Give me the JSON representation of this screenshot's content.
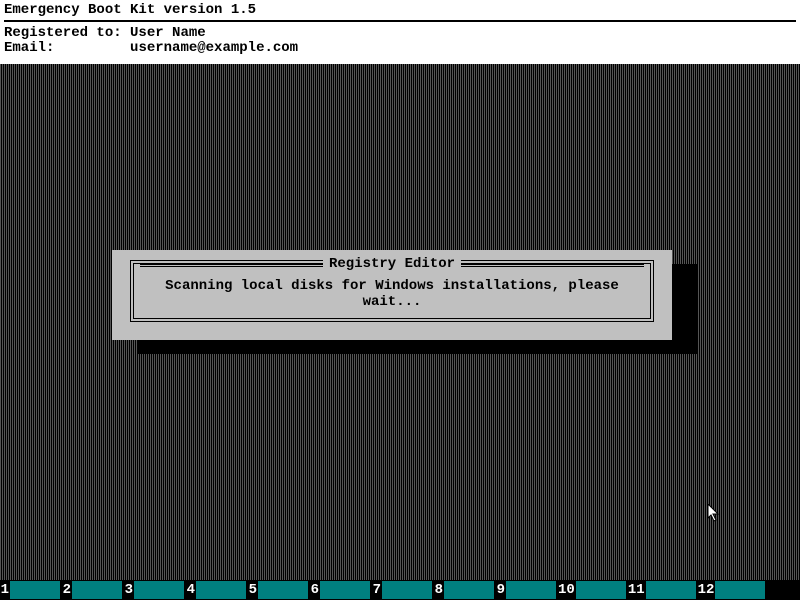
{
  "header": {
    "title": "Emergency Boot Kit version 1.5",
    "registered_label": "Registered to:",
    "registered_value": "User Name",
    "email_label": "Email:",
    "email_value": "username@example.com"
  },
  "dialog": {
    "title": "Registry Editor",
    "message": "Scanning local disks for Windows installations, please wait..."
  },
  "fkeys": {
    "items": [
      {
        "num": "1",
        "label": ""
      },
      {
        "num": "2",
        "label": ""
      },
      {
        "num": "3",
        "label": ""
      },
      {
        "num": "4",
        "label": ""
      },
      {
        "num": "5",
        "label": ""
      },
      {
        "num": "6",
        "label": ""
      },
      {
        "num": "7",
        "label": ""
      },
      {
        "num": "8",
        "label": ""
      },
      {
        "num": "9",
        "label": ""
      },
      {
        "num": "10",
        "label": ""
      },
      {
        "num": "11",
        "label": ""
      },
      {
        "num": "12",
        "label": ""
      }
    ]
  },
  "colors": {
    "teal": "#008080",
    "panel": "#c0c0c0"
  }
}
